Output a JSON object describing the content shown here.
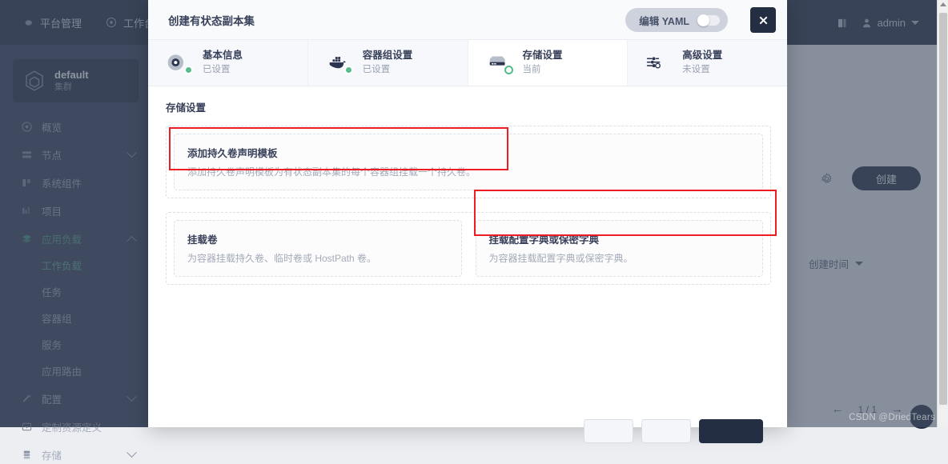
{
  "topbar": {
    "nav": [
      {
        "label": "平台管理",
        "icon": "gear-icon"
      },
      {
        "label": "工作台",
        "icon": "dashboard-icon"
      }
    ],
    "doc_icon": "book-icon",
    "user": {
      "name": "admin",
      "avatar_icon": "user-icon",
      "caret_icon": "chevron-down-icon"
    }
  },
  "sidebar": {
    "cluster": {
      "name": "default",
      "subtitle": "集群",
      "icon": "cube-icon"
    },
    "items": [
      {
        "label": "概览",
        "icon": "overview-icon",
        "expandable": false,
        "active": false
      },
      {
        "label": "节点",
        "icon": "nodes-icon",
        "expandable": true,
        "expanded": false,
        "active": false
      },
      {
        "label": "系统组件",
        "icon": "components-icon",
        "expandable": false,
        "active": false
      },
      {
        "label": "项目",
        "icon": "projects-icon",
        "expandable": false,
        "active": false
      },
      {
        "label": "应用负载",
        "icon": "workload-icon",
        "expandable": true,
        "expanded": true,
        "active": true
      }
    ],
    "subitems": [
      {
        "label": "工作负载",
        "selected": true
      },
      {
        "label": "任务",
        "selected": false
      },
      {
        "label": "容器组",
        "selected": false
      },
      {
        "label": "服务",
        "selected": false
      },
      {
        "label": "应用路由",
        "selected": false
      }
    ],
    "items_after": [
      {
        "label": "配置",
        "icon": "config-icon",
        "expandable": true,
        "expanded": false
      },
      {
        "label": "定制资源定义",
        "icon": "crd-icon",
        "expandable": false
      },
      {
        "label": "存储",
        "icon": "storage-icon",
        "expandable": true,
        "expanded": false
      }
    ]
  },
  "background": {
    "gear_icon": "gear-icon",
    "create_button": "创建",
    "sort_label": "创建时间",
    "sort_caret_icon": "chevron-down-icon",
    "pager": {
      "prev_icon": "arrow-left-icon",
      "page": "1 / 1",
      "next_icon": "arrow-right-icon"
    }
  },
  "modal": {
    "title": "创建有状态副本集",
    "yaml_toggle": {
      "label": "编辑 YAML",
      "checked": false
    },
    "close_icon": "close-icon",
    "steps": [
      {
        "title": "基本信息",
        "status": "已设置",
        "icon": "basic-info-icon",
        "state": "done"
      },
      {
        "title": "容器组设置",
        "status": "已设置",
        "icon": "docker-icon",
        "state": "done"
      },
      {
        "title": "存储设置",
        "status": "当前",
        "icon": "harddrive-icon",
        "state": "current"
      },
      {
        "title": "高级设置",
        "status": "未设置",
        "icon": "sliders-icon",
        "state": "todo"
      }
    ],
    "section_title": "存储设置",
    "cards": [
      {
        "title": "添加持久卷声明模板",
        "desc": "添加持久卷声明模板为有状态副本集的每个容器组挂载一个持久卷。",
        "highlighted": true
      },
      {
        "title": "挂载卷",
        "desc": "为容器挂载持久卷、临时卷或 HostPath 卷。",
        "highlighted": false
      },
      {
        "title": "挂载配置字典或保密字典",
        "desc": "为容器挂载配置字典或保密字典。",
        "highlighted": true
      }
    ]
  },
  "watermark": "CSDN @DriedTears",
  "colors": {
    "accent_green": "#55bc8a",
    "dark_navy": "#242e42",
    "annotation_red": "#ee1d23",
    "sidebar": "#36405a"
  }
}
